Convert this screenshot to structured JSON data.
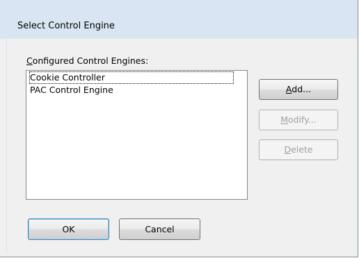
{
  "window": {
    "title": "Select Control Engine"
  },
  "list": {
    "label_first": "C",
    "label_rest": "onfigured Control Engines:",
    "items": [
      {
        "label": "Cookie Controller",
        "focused": true
      },
      {
        "label": "PAC Control Engine",
        "focused": false
      }
    ]
  },
  "buttons": {
    "add": {
      "mnemonic": "A",
      "rest": "dd...",
      "enabled": true
    },
    "modify": {
      "mnemonic": "M",
      "rest": "odify...",
      "enabled": false
    },
    "delete": {
      "mnemonic": "D",
      "rest": "elete",
      "enabled": false
    },
    "ok": {
      "label": "OK",
      "default": true
    },
    "cancel": {
      "label": "Cancel"
    }
  },
  "colors": {
    "titlebar": "#d9e5f3",
    "dialog_bg": "#f0f0f0",
    "disabled_text": "#a0a0a0",
    "default_button_border": "#3c7fb1"
  }
}
